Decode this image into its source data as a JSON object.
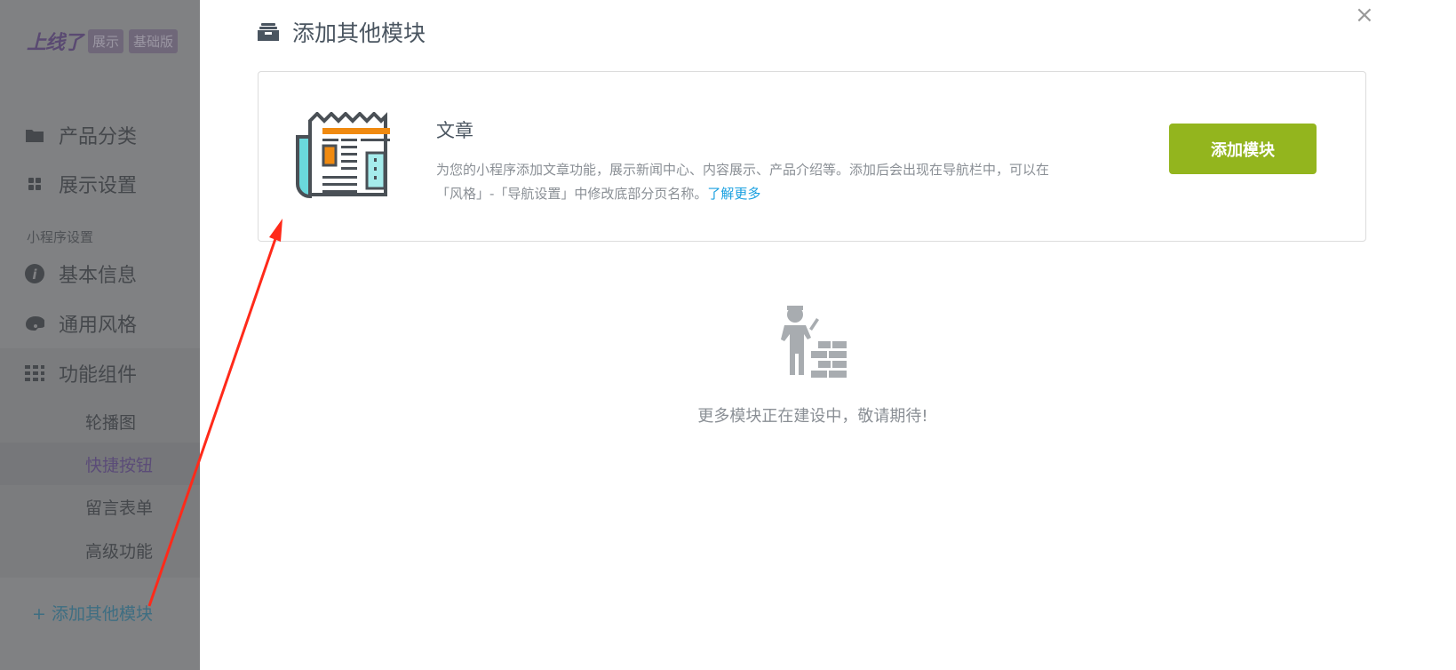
{
  "sidebar": {
    "brand": "上线了",
    "tags": [
      "展示",
      "基础版"
    ],
    "items": [
      {
        "label": "产品分类",
        "icon": "folder-icon"
      },
      {
        "label": "展示设置",
        "icon": "grid-small-icon"
      }
    ],
    "section_label": "小程序设置",
    "settings": [
      {
        "label": "基本信息",
        "icon": "info-icon"
      },
      {
        "label": "通用风格",
        "icon": "palette-icon"
      },
      {
        "label": "功能组件",
        "icon": "apps-icon"
      }
    ],
    "sub_items": [
      "轮播图",
      "快捷按钮",
      "留言表单",
      "高级功能"
    ],
    "active_sub": "快捷按钮",
    "add_module": "+ 添加其他模块"
  },
  "modal": {
    "title": "添加其他模块",
    "close": "×",
    "card": {
      "title": "文章",
      "desc": "为您的小程序添加文章功能，展示新闻中心、内容展示、产品介绍等。添加后会出现在导航栏中，可以在 「风格」-「导航设置」中修改底部分页名称。",
      "link": "了解更多",
      "button": "添加模块"
    },
    "empty_text": "更多模块正在建设中，敬请期待!"
  },
  "colors": {
    "accent": "#93b51e",
    "link": "#1aa0e0",
    "annotation": "#ff2a1a"
  }
}
